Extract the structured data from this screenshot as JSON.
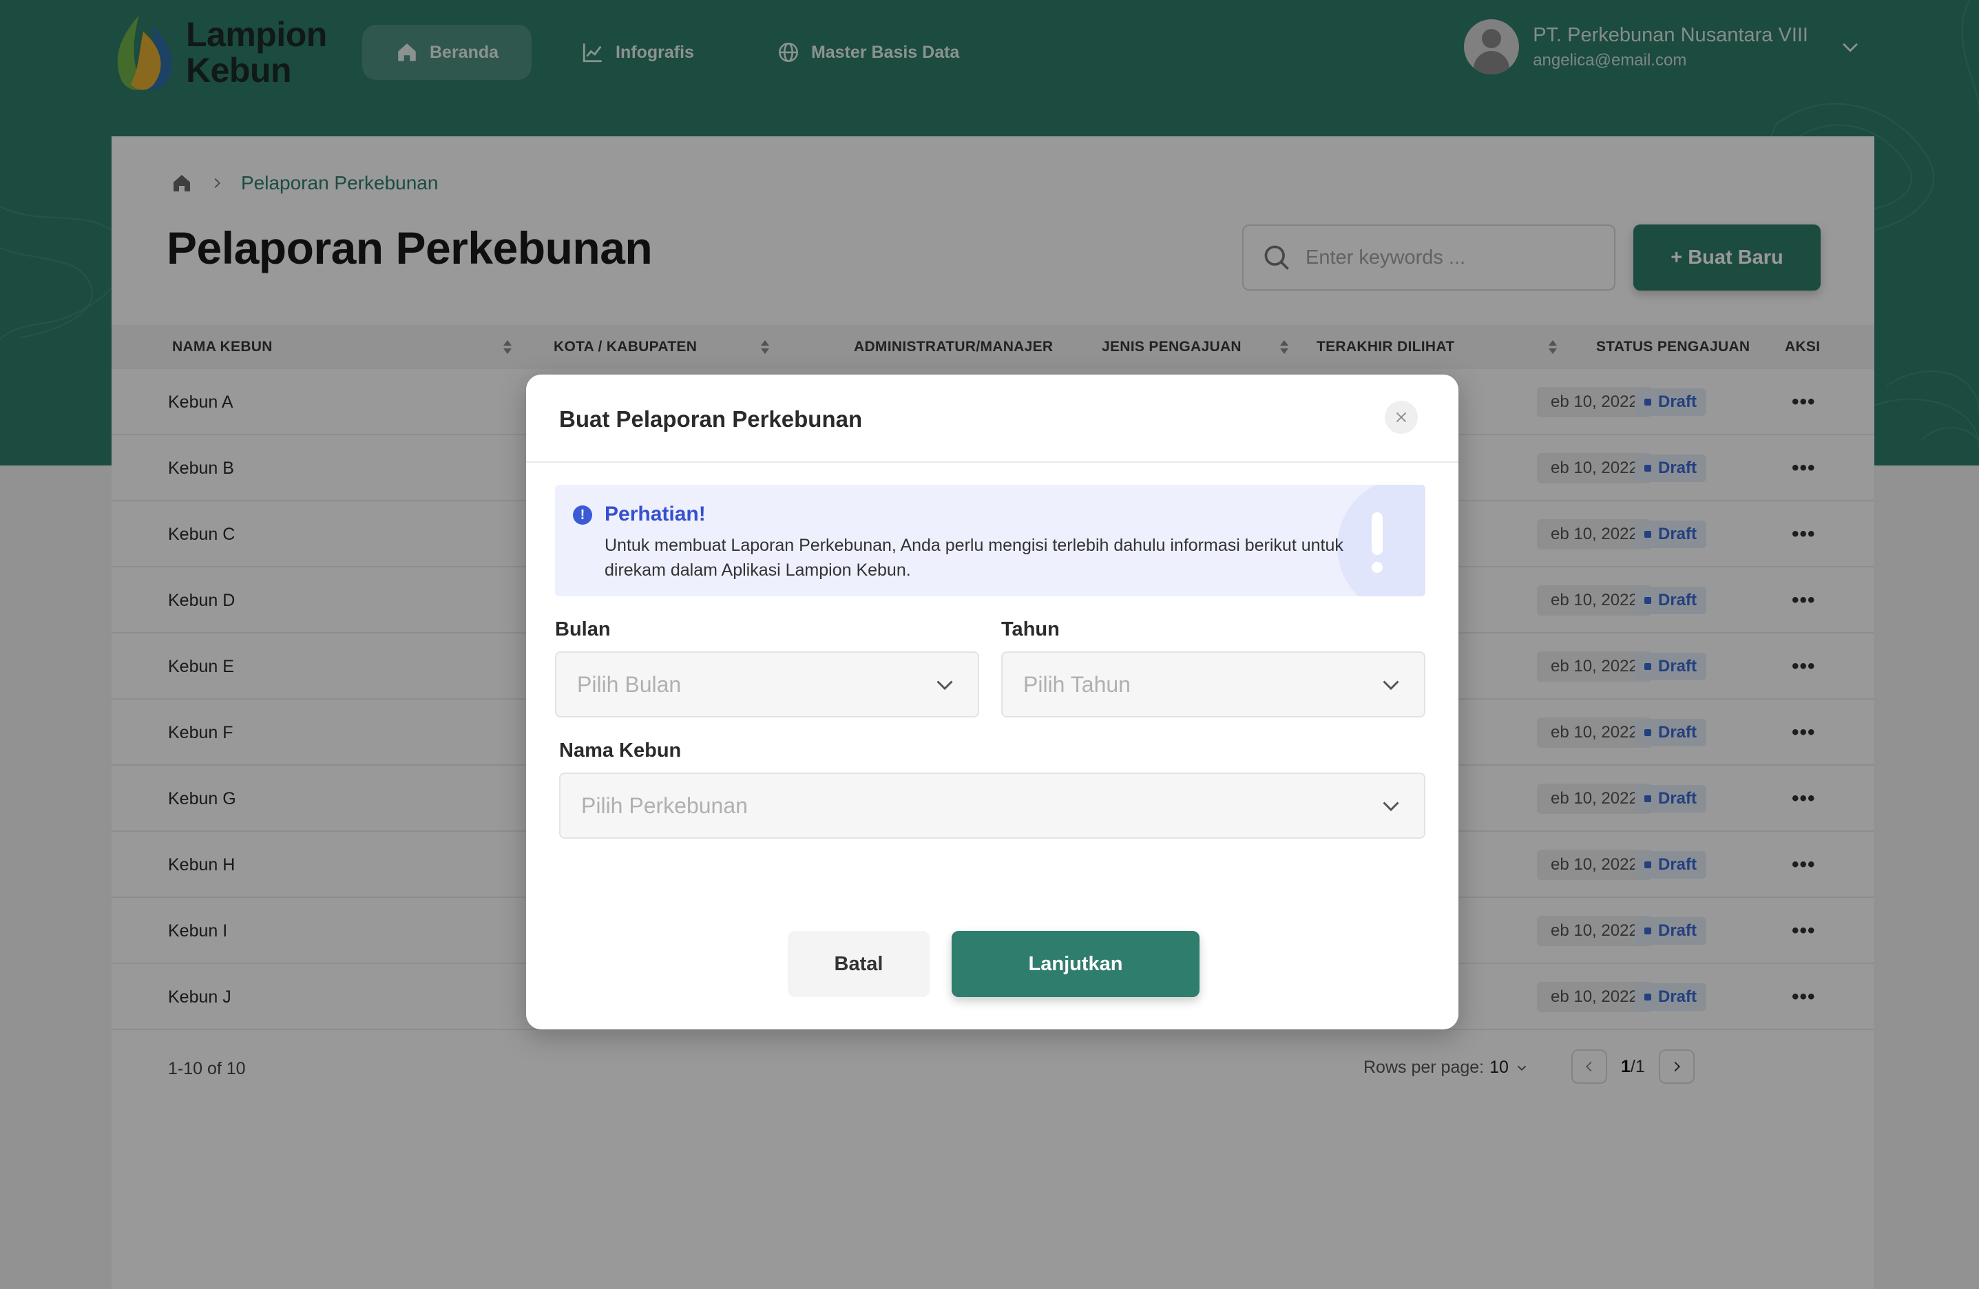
{
  "app": {
    "logo_line1": "Lampion",
    "logo_line2": "Kebun",
    "nav": [
      {
        "label": "Beranda",
        "icon": "home-icon",
        "active": true
      },
      {
        "label": "Infografis",
        "icon": "chart-line-icon",
        "active": false
      },
      {
        "label": "Master Basis Data",
        "icon": "globe-icon",
        "active": false
      }
    ],
    "user": {
      "name": "PT. Perkebunan Nusantara VIII",
      "email": "angelica@email.com"
    }
  },
  "page": {
    "breadcrumb": "Pelaporan Perkebunan",
    "title": "Pelaporan Perkebunan",
    "search_placeholder": "Enter keywords ...",
    "new_button": "+ Buat Baru"
  },
  "table": {
    "columns": [
      "NAMA KEBUN",
      "KOTA / KABUPATEN",
      "ADMINISTRATUR/MANAJER",
      "JENIS PENGAJUAN",
      "TERAKHIR DILIHAT",
      "STATUS PENGAJUAN",
      "AKSI"
    ],
    "rows": [
      {
        "name": "Kebun A",
        "date": "eb 10, 2022",
        "status": "Draft"
      },
      {
        "name": "Kebun B",
        "date": "eb 10, 2022",
        "status": "Draft"
      },
      {
        "name": "Kebun C",
        "date": "eb 10, 2022",
        "status": "Draft"
      },
      {
        "name": "Kebun D",
        "date": "eb 10, 2022",
        "status": "Draft"
      },
      {
        "name": "Kebun E",
        "date": "eb 10, 2022",
        "status": "Draft"
      },
      {
        "name": "Kebun F",
        "date": "eb 10, 2022",
        "status": "Draft"
      },
      {
        "name": "Kebun G",
        "date": "eb 10, 2022",
        "status": "Draft"
      },
      {
        "name": "Kebun H",
        "date": "eb 10, 2022",
        "status": "Draft"
      },
      {
        "name": "Kebun I",
        "date": "eb 10, 2022",
        "status": "Draft"
      },
      {
        "name": "Kebun J",
        "date": "eb 10, 2022",
        "status": "Draft"
      }
    ],
    "footer": {
      "count": "1-10 of 10",
      "rows_per_page_label": "Rows per page:",
      "rows_per_page_value": "10",
      "page_current": "1",
      "page_total": "/1"
    }
  },
  "modal": {
    "title": "Buat Pelaporan Perkebunan",
    "alert_title": "Perhatian!",
    "alert_text": "Untuk membuat Laporan Perkebunan, Anda perlu mengisi terlebih dahulu informasi berikut untuk direkam dalam Aplikasi Lampion Kebun.",
    "bulan_label": "Bulan",
    "bulan_placeholder": "Pilih Bulan",
    "tahun_label": "Tahun",
    "tahun_placeholder": "Pilih Tahun",
    "kebun_label": "Nama Kebun",
    "kebun_placeholder": "Pilih Perkebunan",
    "cancel": "Batal",
    "next": "Lanjutkan"
  },
  "colors": {
    "brand": "#2f7d6c",
    "status_text": "#3b6bd4",
    "alert_title": "#3550cf"
  }
}
